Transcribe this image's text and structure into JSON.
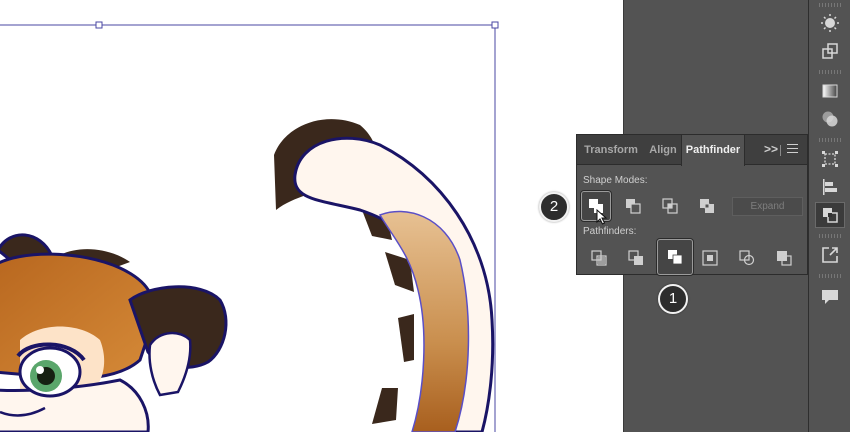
{
  "panel": {
    "tabs": [
      {
        "label": "Transform"
      },
      {
        "label": "Align"
      },
      {
        "label": "Pathfinder"
      }
    ],
    "more_glyph": ">>",
    "shape_modes_label": "Shape Modes:",
    "pathfinders_label": "Pathfinders:",
    "expand_label": "Expand",
    "shape_modes": [
      "unite-icon",
      "minus-front-icon",
      "intersect-icon",
      "exclude-icon"
    ],
    "pathfinders": [
      "divide-icon",
      "trim-icon",
      "merge-icon",
      "crop-icon",
      "outline-icon",
      "minus-back-icon"
    ]
  },
  "markers": {
    "step_one": "1",
    "step_two": "2"
  },
  "dock": {
    "tools": [
      "appearance-icon",
      "transform-icon",
      "gradient-icon",
      "transparency-icon",
      "artboards-icon",
      "align-icon",
      "pathfinder-icon",
      "export-icon",
      "comments-icon"
    ],
    "active_tool": "pathfinder-icon"
  },
  "colors": {
    "pasteboard": "#535353",
    "panel_bg": "#535353",
    "tab_bar": "#3f3f3f",
    "selection_outline": "#2f2b8f",
    "fur_orange": "#c4762a",
    "fur_dark": "#3a281c",
    "cream": "#fff6ee",
    "eye_green": "#5aa66b"
  }
}
